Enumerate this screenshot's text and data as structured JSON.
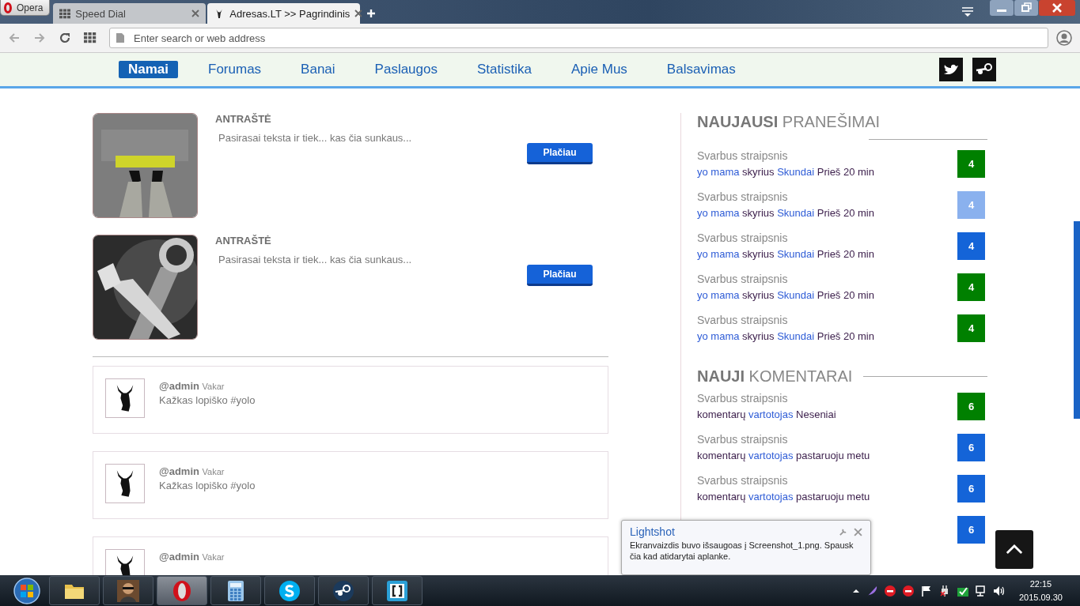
{
  "browser": {
    "menu_button": "Opera",
    "tabs": [
      {
        "title": "Speed Dial",
        "selected": false,
        "kind": "grid"
      },
      {
        "title": "Adresas.LT >> Pagrindinis",
        "selected": true,
        "kind": "site"
      }
    ],
    "address": {
      "placeholder": "Enter search or web address"
    }
  },
  "nav": {
    "items": [
      {
        "label": "Namai",
        "selected": true
      },
      {
        "label": "Forumas",
        "selected": false
      },
      {
        "label": "Banai",
        "selected": false
      },
      {
        "label": "Paslaugos",
        "selected": false
      },
      {
        "label": "Statistika",
        "selected": false
      },
      {
        "label": "Apie Mus",
        "selected": false
      },
      {
        "label": "Balsavimas",
        "selected": false
      }
    ]
  },
  "posts": [
    {
      "kind": "start",
      "title": "ANTRAŠTĖ",
      "text": "Pasirasai teksta ir tiek... kas čia sunkaus...",
      "button": "Plačiau"
    },
    {
      "kind": "wrench",
      "title": "ANTRAŠTĖ",
      "text": "Pasirasai teksta ir tiek... kas čia sunkaus...",
      "button": "Plačiau"
    }
  ],
  "shouts": [
    {
      "user": "@admin",
      "time": "Vakar",
      "text": "Kažkas lopiško #yolo"
    },
    {
      "user": "@admin",
      "time": "Vakar",
      "text": "Kažkas lopiško #yolo"
    },
    {
      "user": "@admin",
      "time": "Vakar"
    }
  ],
  "latest": {
    "heading": "**NAUJAUSI** PRANEŠIMAI",
    "items": [
      {
        "title": "Svarbus straipsnis",
        "author": "yo mama",
        "label": "skyrius",
        "category": "Skundai",
        "time": "Prieš 20 min",
        "count": "4",
        "color": "#008000"
      },
      {
        "title": "Svarbus straipsnis",
        "author": "yo mama",
        "label": "skyrius",
        "category": "Skundai",
        "time": "Prieš 20 min",
        "count": "4",
        "color": "#8ab1ee"
      },
      {
        "title": "Svarbus straipsnis",
        "author": "yo mama",
        "label": "skyrius",
        "category": "Skundai",
        "time": "Prieš 20 min",
        "count": "4",
        "color": "#1464d8"
      },
      {
        "title": "Svarbus straipsnis",
        "author": "yo mama",
        "label": "skyrius",
        "category": "Skundai",
        "time": "Prieš 20 min",
        "count": "4",
        "color": "#008000"
      },
      {
        "title": "Svarbus straipsnis",
        "author": "yo mama",
        "label": "skyrius",
        "category": "Skundai",
        "time": "Prieš 20 min",
        "count": "4",
        "color": "#008000"
      }
    ]
  },
  "comments": {
    "heading": "**NAUJI** KOMENTARAI",
    "items": [
      {
        "title": "Svarbus straipsnis",
        "label": "komentarų",
        "author": "vartotojas",
        "time": "Neseniai",
        "count": "6",
        "color": "#008000"
      },
      {
        "title": "Svarbus straipsnis",
        "label": "komentarų",
        "author": "vartotojas",
        "time": "pastaruoju metu",
        "count": "6",
        "color": "#1464d8"
      },
      {
        "title": "Svarbus straipsnis",
        "label": "komentarų",
        "author": "vartotojas",
        "time": "pastaruoju metu",
        "count": "6",
        "color": "#1464d8"
      },
      {
        "count": "6",
        "color": "#1464d8"
      }
    ]
  },
  "notification": {
    "title": "Lightshot",
    "text": "Ekranvaizdis buvo išsaugoas į Screenshot_1.png. Spausk čia kad atidarytai aplanke."
  },
  "taskbar": {
    "apps": [
      {
        "kind": "folder",
        "active": false
      },
      {
        "kind": "person",
        "active": false
      },
      {
        "kind": "opera",
        "active": true
      },
      {
        "kind": "calculator",
        "active": false
      },
      {
        "kind": "skype",
        "active": false
      },
      {
        "kind": "steam",
        "active": false
      },
      {
        "kind": "brackets",
        "active": false
      }
    ],
    "time": "22:15",
    "date": "2015.09.30"
  }
}
